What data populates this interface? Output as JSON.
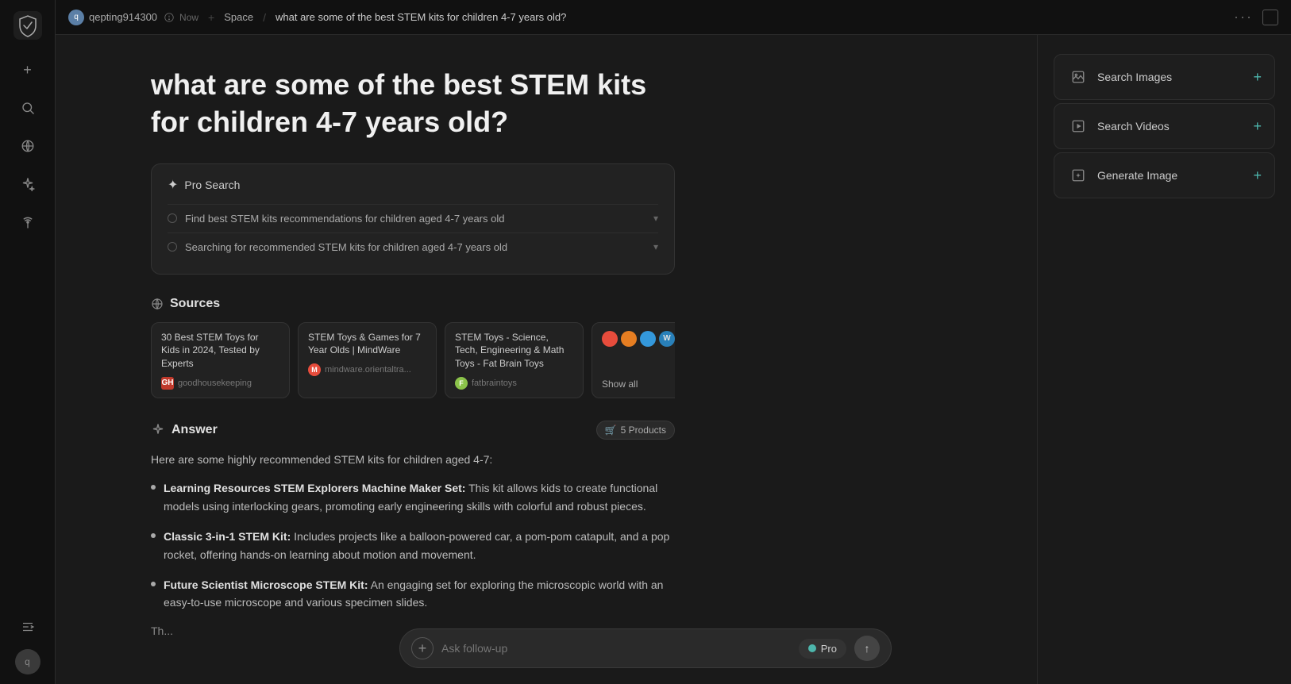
{
  "topbar": {
    "username": "qepting914300",
    "user_initial": "q",
    "time_label": "Now",
    "space_label": "Space",
    "separator": "/",
    "page_title": "what are some of the best STEM kits for children 4-7 years old?",
    "dots": "···"
  },
  "sidebar": {
    "new_btn": "+",
    "icons": [
      "search",
      "globe",
      "sparkle",
      "antenna"
    ],
    "collapse": "|→",
    "avatar_initial": "q"
  },
  "page": {
    "title": "what are some of the best STEM kits for children 4-7 years old?"
  },
  "pro_search": {
    "label": "Pro Search",
    "steps": [
      {
        "text": "Find best STEM kits recommendations for children aged 4-7 years old"
      },
      {
        "text": "Searching for recommended STEM kits for children aged 4-7 years old"
      }
    ]
  },
  "sources": {
    "label": "Sources",
    "items": [
      {
        "title": "30 Best STEM Toys for Kids in 2024, Tested by Experts",
        "domain": "goodhousekeeping",
        "favicon_label": "GH",
        "favicon_class": "favicon-gh"
      },
      {
        "title": "STEM Toys & Games for 7 Year Olds | MindWare",
        "domain": "mindware.orientaltra...",
        "favicon_label": "M",
        "favicon_class": "favicon-mw"
      },
      {
        "title": "STEM Toys - Science, Tech, Engineering & Math Toys - Fat Brain Toys",
        "domain": "fatbraintoys",
        "favicon_label": "F",
        "favicon_class": "favicon-fb"
      }
    ],
    "show_all": "Show all",
    "multi_favicons": [
      "🔴",
      "🟠",
      "🌐",
      "🔵"
    ]
  },
  "answer": {
    "label": "Answer",
    "products_label": "5 Products",
    "cart_icon": "🛒",
    "intro": "Here are some highly recommended STEM kits for children aged 4-7:",
    "items": [
      {
        "title": "Learning Resources STEM Explorers Machine Maker Set:",
        "desc": "This kit allows kids to create functional models using interlocking gears, promoting early engineering skills with colorful and robust pieces."
      },
      {
        "title": "Classic 3-in-1 STEM Kit:",
        "desc": "Includes projects like a balloon-powered car, a pom-pom catapult, and a pop rocket, offering hands-on learning about motion and movement."
      },
      {
        "title": "Future Scientist Microscope STEM Kit:",
        "desc": "An engaging set for exploring the microscopic world with an easy-to-use microscope and various specimen slides."
      }
    ],
    "fade_text": "Th..."
  },
  "right_panel": {
    "actions": [
      {
        "icon": "🖼",
        "label": "Search Images",
        "plus": "+"
      },
      {
        "icon": "▶",
        "label": "Search Videos",
        "plus": "+"
      },
      {
        "icon": "🖼",
        "label": "Generate Image",
        "plus": "+"
      }
    ]
  },
  "bottom_bar": {
    "placeholder": "Ask follow-up",
    "pro_label": "Pro",
    "send_icon": "↑"
  }
}
